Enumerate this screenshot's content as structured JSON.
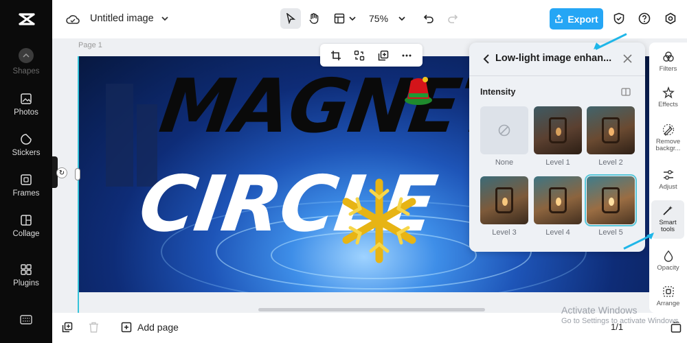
{
  "app": {
    "document_title": "Untitled image",
    "zoom": "75%",
    "export_label": "Export",
    "page_label": "Page 1"
  },
  "sidebar": {
    "items": [
      {
        "label": "Shapes",
        "icon": "shapes-icon"
      },
      {
        "label": "Photos",
        "icon": "photo-icon"
      },
      {
        "label": "Stickers",
        "icon": "sticker-icon"
      },
      {
        "label": "Frames",
        "icon": "frame-icon"
      },
      {
        "label": "Collage",
        "icon": "collage-icon"
      },
      {
        "label": "Plugins",
        "icon": "plugins-icon"
      }
    ]
  },
  "canvas": {
    "headline_top": "MAGNETO",
    "headline_bottom": "CIRCLE"
  },
  "panel": {
    "title": "Low-light image enhan...",
    "section": "Intensity",
    "options": [
      {
        "label": "None"
      },
      {
        "label": "Level 1"
      },
      {
        "label": "Level 2"
      },
      {
        "label": "Level 3"
      },
      {
        "label": "Level 4"
      },
      {
        "label": "Level 5",
        "selected": true
      }
    ]
  },
  "rail": {
    "items": [
      {
        "label": "Filters",
        "icon": "filters-icon"
      },
      {
        "label": "Effects",
        "icon": "effects-icon"
      },
      {
        "label": "Remove backgr...",
        "icon": "remove-background-icon"
      },
      {
        "label": "Adjust",
        "icon": "adjust-icon"
      },
      {
        "label": "Smart tools",
        "icon": "smart-tools-icon",
        "active": true
      },
      {
        "label": "Opacity",
        "icon": "opacity-icon"
      },
      {
        "label": "Arrange",
        "icon": "arrange-icon"
      }
    ]
  },
  "bottom": {
    "add_page": "Add page",
    "pager": "1/1"
  },
  "watermark": {
    "line1": "Activate Windows",
    "line2": "Go to Settings to activate Windows."
  },
  "colors": {
    "accent": "#25a6f5",
    "sidebar_bg": "#0b0b0b",
    "selection": "#57c6d8",
    "annotation_arrow": "#1fb6e8"
  }
}
